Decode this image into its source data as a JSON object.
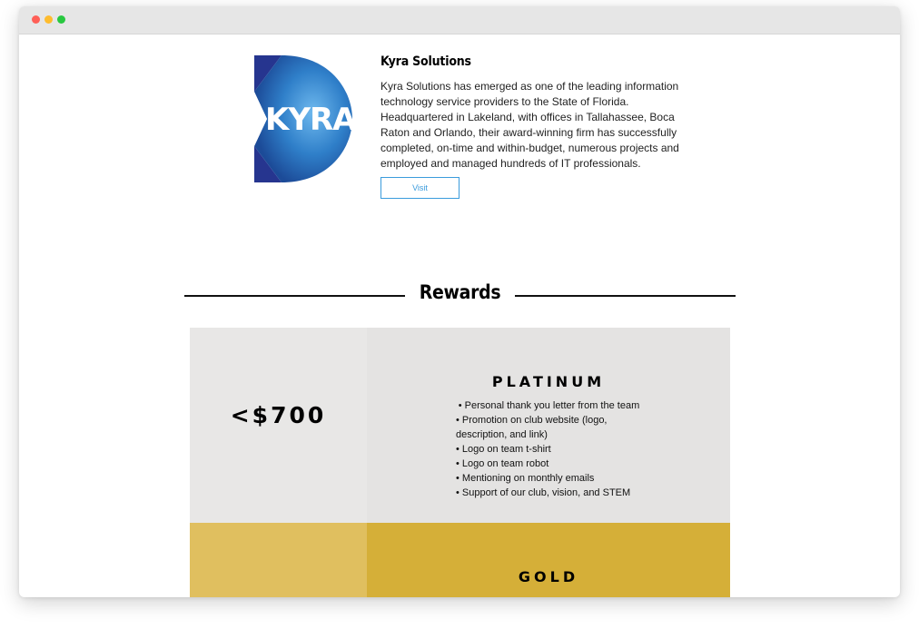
{
  "sponsor": {
    "name": "Kyra Solutions",
    "logo_text": "KYRA",
    "description": "Kyra Solutions has emerged as one of the leading information technology service providers to the State of Florida. Headquartered in Lakeland, with offices in Tallahassee, Boca Raton and Orlando, their award-winning firm has successfully completed, on-time and within-budget, numerous projects and employed and managed hundreds of IT professionals.",
    "visit_label": "Visit"
  },
  "rewards": {
    "title": "Rewards",
    "tiers": [
      {
        "price": "<$700",
        "name": "PLATINUM",
        "perks": [
          "• Personal thank you letter from the team",
          "• Promotion on club website (logo, description, and link)",
          "• Logo on team t-shirt",
          "• Logo on team robot",
          "• Mentioning on monthly emails",
          "• Support of our club, vision, and STEM"
        ]
      },
      {
        "price": "",
        "name": "GOLD",
        "perks": []
      }
    ]
  },
  "colors": {
    "platinum_price_bg": "#e8e7e6",
    "platinum_body_bg": "#e4e3e2",
    "gold_price_bg": "#e0bf5f",
    "gold_body_bg": "#d5af38",
    "visit_accent": "#3a9bdc"
  }
}
